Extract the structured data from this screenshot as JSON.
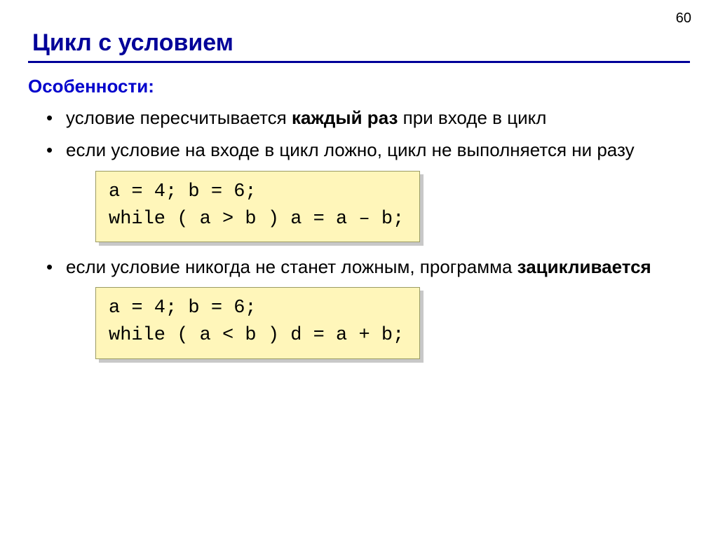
{
  "page_number": "60",
  "title": "Цикл с условием",
  "subhead": "Особенности:",
  "bullets": {
    "b1_a": "условие пересчитывается ",
    "b1_b": "каждый раз",
    "b1_c": " при входе в цикл",
    "b2": "если условие на входе в цикл ложно, цикл не выполняется ни разу",
    "b3_a": "если условие никогда не станет ложным, программа ",
    "b3_b": "зацикливается"
  },
  "code1": "a = 4; b = 6;\nwhile ( a > b ) a = a – b;",
  "code2": "a = 4; b = 6;\nwhile ( a < b ) d = a + b;"
}
